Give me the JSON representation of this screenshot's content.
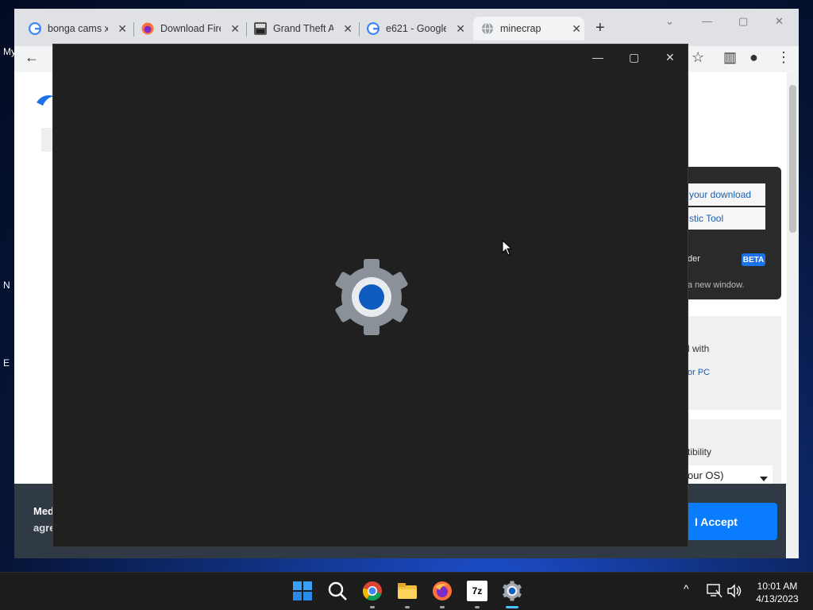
{
  "desktop": {
    "icon_labels": [
      "My",
      "N",
      "E"
    ]
  },
  "browser": {
    "tabs": [
      {
        "label": "bonga cams x",
        "icon": "google-icon"
      },
      {
        "label": "Download Fire",
        "icon": "firefox-icon"
      },
      {
        "label": "Grand Theft A",
        "icon": "gta-icon"
      },
      {
        "label": "e621 - Google",
        "icon": "google-icon"
      },
      {
        "label": "minecrap",
        "icon": "globe-icon"
      }
    ],
    "tab_close": "✕",
    "new_tab": "+",
    "window_controls": {
      "dropdown": "⌄",
      "minimize": "—",
      "maximize": "▢",
      "close": "✕"
    },
    "toolbar": {
      "back": "←",
      "star": "☆",
      "sidepanel": "▥",
      "profile": "●",
      "menu": "⋮"
    }
  },
  "page": {
    "link_your_download": "your download",
    "link_diag_tool": "stic Tool",
    "panel_ader": "der",
    "beta": "BETA",
    "panel_new_window": "a new window.",
    "box1_text": "l with",
    "box1_link": "or PC",
    "box2_text": "tibility",
    "box2_select": "our OS)",
    "cookie_line1": "Med",
    "cookie_line2": "agre",
    "accept": "I Accept"
  },
  "settings_window": {
    "minimize": "—",
    "maximize": "▢",
    "close": "✕"
  },
  "taskbar": {
    "time": "10:01 AM",
    "date": "4/13/2023",
    "tray_chevron": "^",
    "apps": [
      "start",
      "search",
      "chrome",
      "file-explorer",
      "firefox",
      "7zip",
      "settings"
    ],
    "seven_zip_label": "7z"
  },
  "colors": {
    "accent_blue": "#0a7cff",
    "settings_bg": "#202020",
    "gear_blue": "#0f5cc0"
  }
}
